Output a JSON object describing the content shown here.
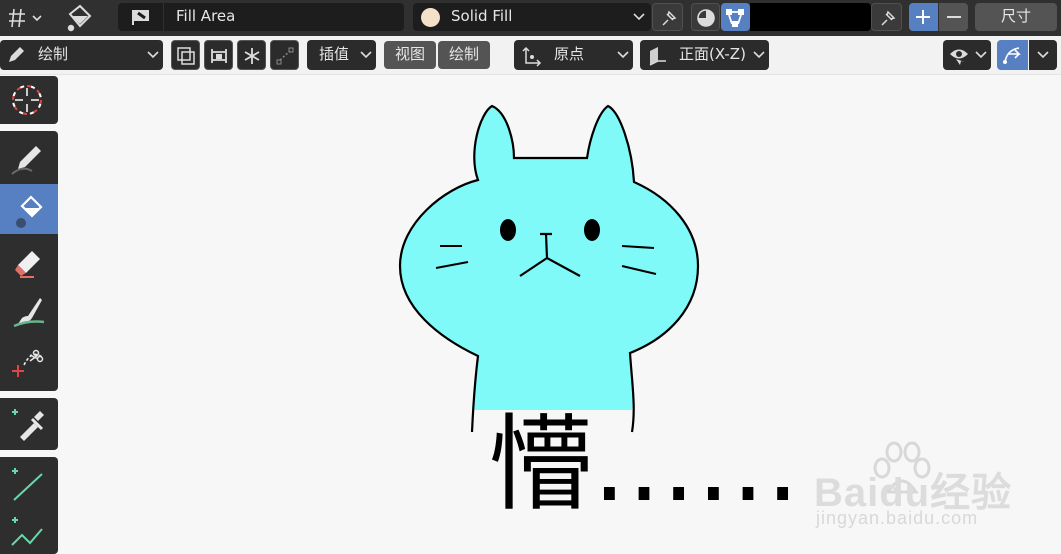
{
  "topbar": {
    "fill_area_label": "Fill Area",
    "material_name": "Solid Fill",
    "size_label": "尺寸",
    "material_swatch_color": "#f5e0c8",
    "color_swatch": "#000000"
  },
  "toolbar": {
    "mode_label": "绘制",
    "interpolate_label": "插值",
    "view_label": "视图",
    "draw_label": "绘制",
    "origin_label": "原点",
    "plane_label": "正面(X-Z)"
  },
  "tools": [
    "cursor",
    "draw",
    "fill",
    "erase",
    "tint",
    "cutter",
    "eyedropper",
    "line",
    "polyline"
  ],
  "canvas": {
    "caption": "懵……",
    "cat_fill_color": "#7ffaf8"
  },
  "watermark": {
    "brand_text": "Baidu经验",
    "url_text": "jingyan.baidu.com"
  },
  "colors": {
    "accent": "#5680c2",
    "header_bg": "#303030",
    "viewport_bg": "#f7f7f7"
  }
}
